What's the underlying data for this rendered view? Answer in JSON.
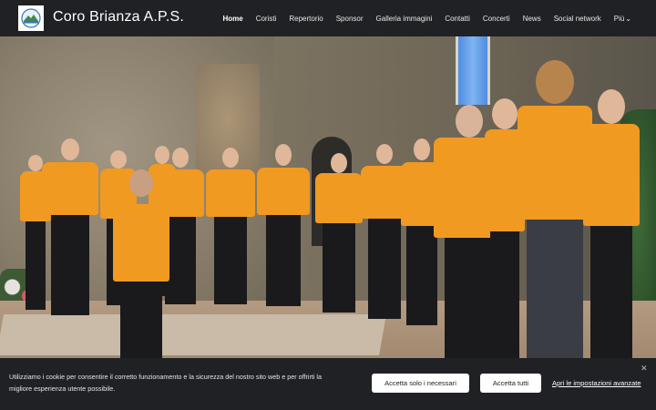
{
  "header": {
    "site_title": "Coro Brianza A.P.S.",
    "logo": "coro-brianza-logo"
  },
  "nav": {
    "items": [
      {
        "label": "Home",
        "active": true
      },
      {
        "label": "Coristi"
      },
      {
        "label": "Repertorio"
      },
      {
        "label": "Sponsor"
      },
      {
        "label": "Galleria immagini"
      },
      {
        "label": "Contatti"
      },
      {
        "label": "Concerti"
      },
      {
        "label": "News"
      },
      {
        "label": "Social network"
      }
    ],
    "more_label": "Più",
    "more_icon": "chevron-down-icon"
  },
  "hero": {
    "image": "choir-in-orange-shirts-singing-in-church"
  },
  "cookie_banner": {
    "text": "Utilizziamo i cookie per consentire il corretto funzionamento e la sicurezza del nostro sito web e per offrirti la migliore esperienza utente possibile.",
    "btn_necessary": "Accetta solo i necessari",
    "btn_accept_all": "Accetta tutti",
    "link_settings": "Apri le impostazioni avanzate",
    "close_icon": "close-icon"
  },
  "colors": {
    "topbar": "#191b20",
    "shirt": "#f09a22",
    "cookie_bg": "#1f2125"
  }
}
